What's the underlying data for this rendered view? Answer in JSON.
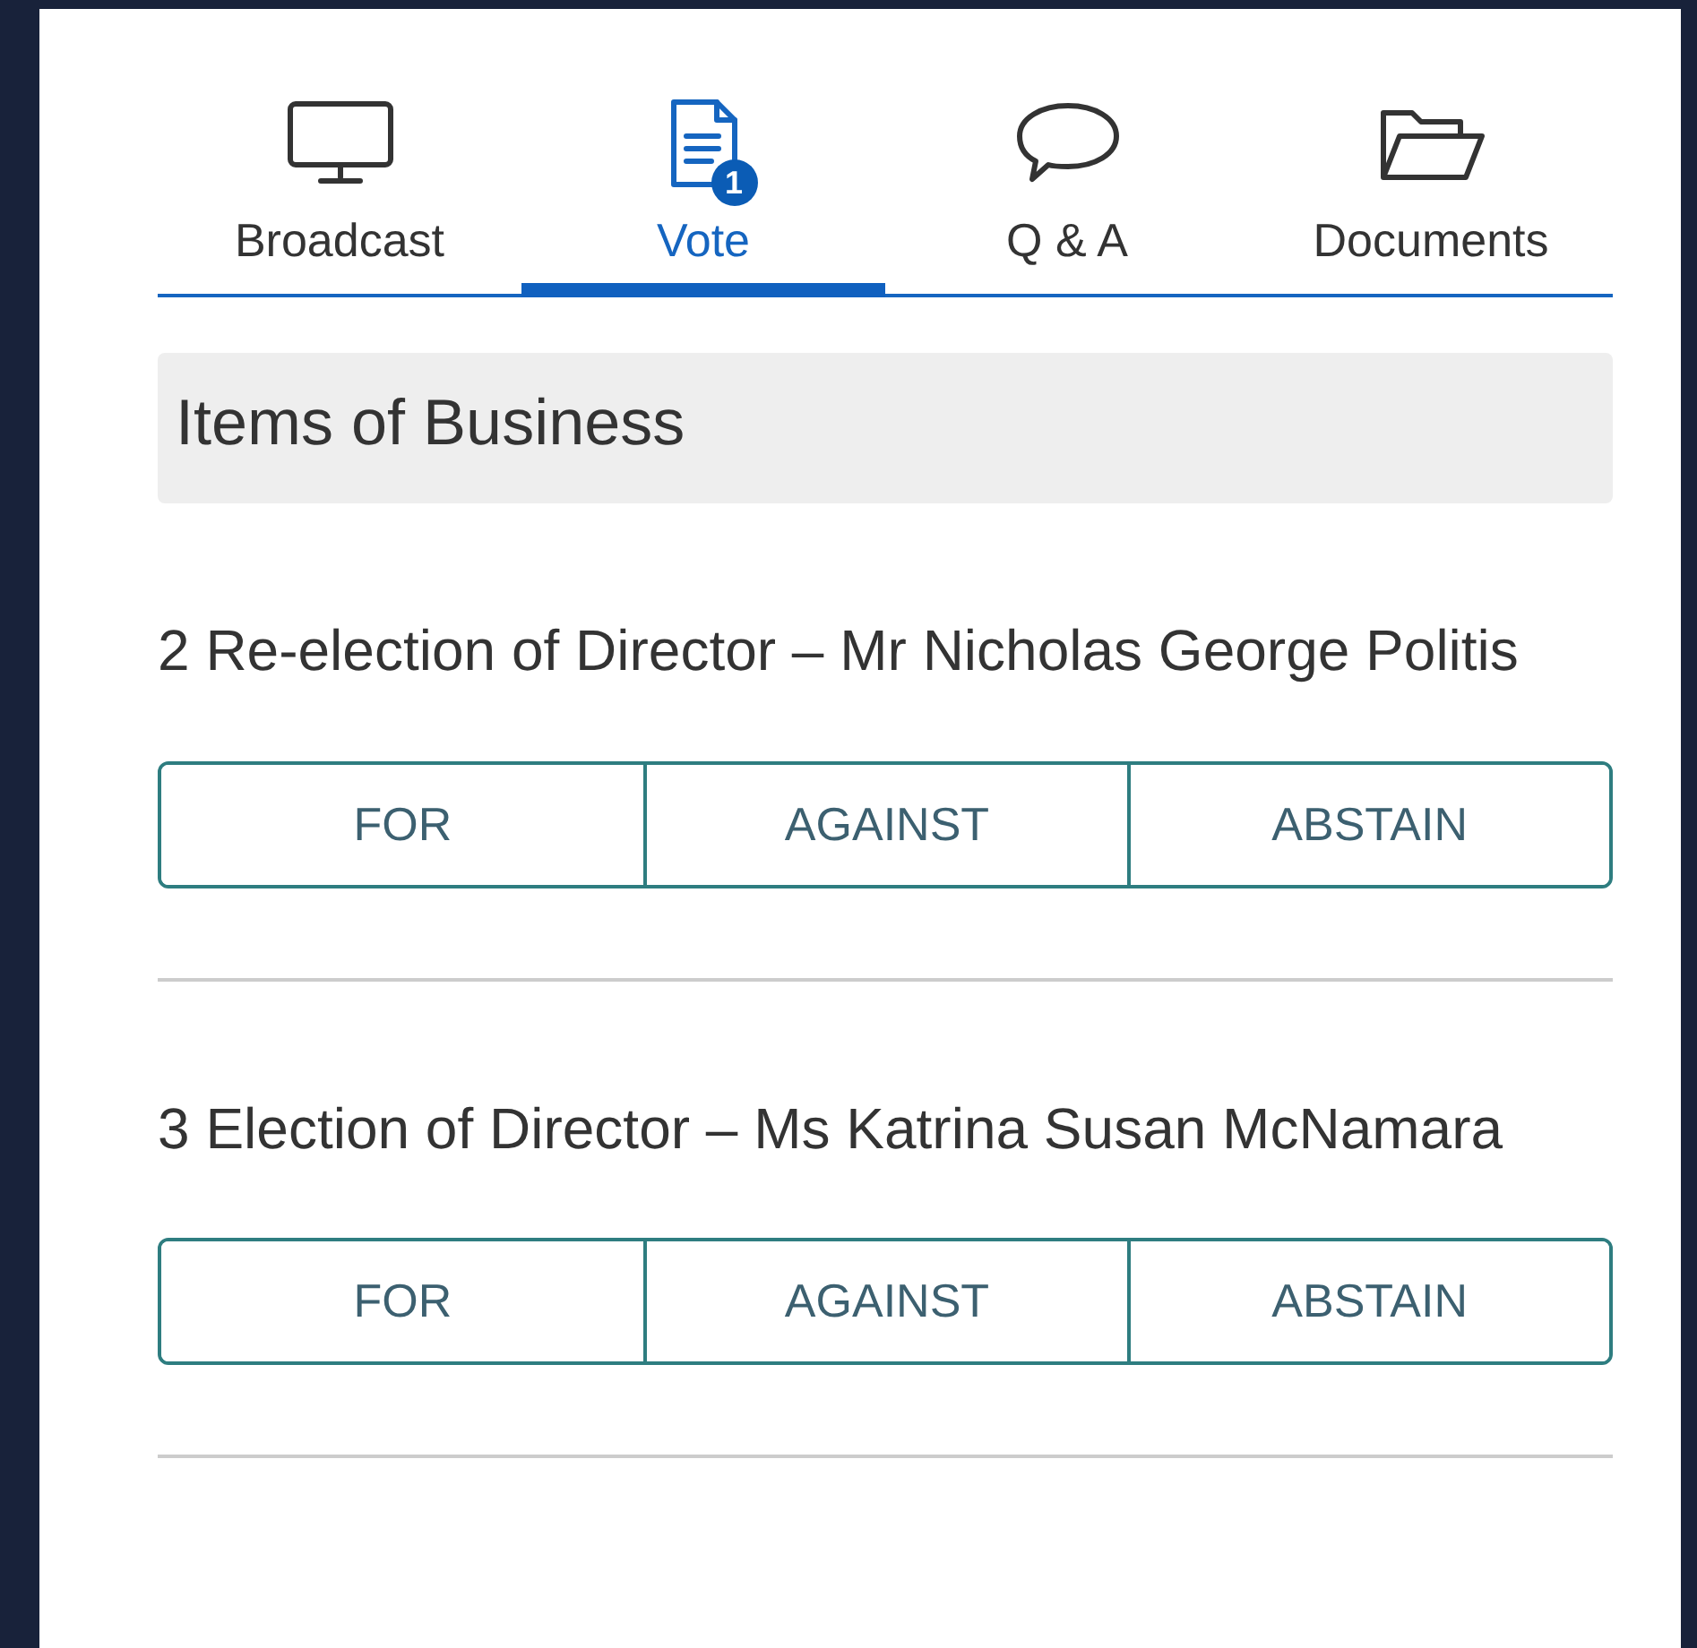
{
  "tabs": [
    {
      "label": "Broadcast",
      "kind": "monitor",
      "selected": false
    },
    {
      "label": "Vote",
      "kind": "document",
      "selected": true,
      "badge": "1"
    },
    {
      "label": "Q & A",
      "kind": "chat",
      "selected": false
    },
    {
      "label": "Documents",
      "kind": "folder",
      "selected": false
    }
  ],
  "section_title": "Items of Business",
  "items": [
    {
      "title": "2 Re-election of Director – Mr Nicholas George Politis",
      "options": [
        {
          "label": "FOR",
          "selected": false
        },
        {
          "label": "AGAINST",
          "selected": false
        },
        {
          "label": "ABSTAIN",
          "selected": false
        }
      ]
    },
    {
      "title": "3 Election of Director – Ms Katrina Susan McNamara",
      "options": [
        {
          "label": "FOR",
          "selected": false
        },
        {
          "label": "AGAINST",
          "selected": false
        },
        {
          "label": "ABSTAIN",
          "selected": false
        }
      ]
    }
  ]
}
